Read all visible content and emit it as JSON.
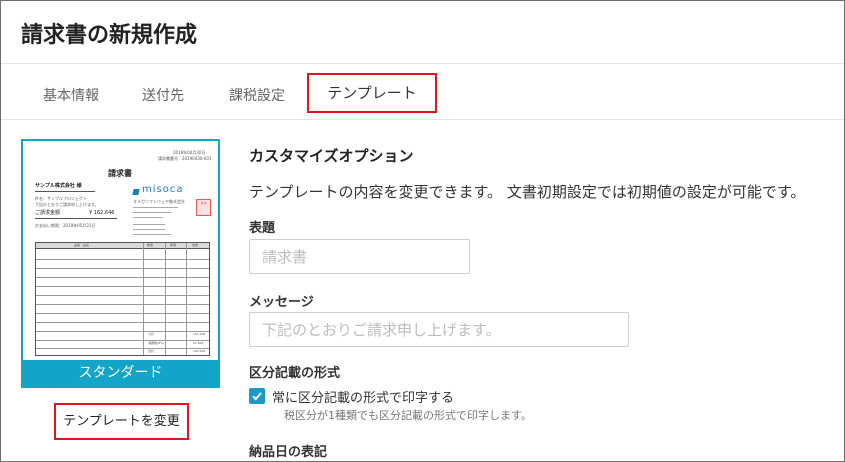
{
  "page": {
    "title": "請求書の新規作成"
  },
  "tabs": [
    {
      "label": "基本情報"
    },
    {
      "label": "送付先"
    },
    {
      "label": "課税設定"
    },
    {
      "label": "テンプレート"
    }
  ],
  "template_preview": {
    "name": "スタンダード",
    "doc_title": "請求書",
    "logo_text": "misoca",
    "client_name": "サンプル株式会社 様",
    "subject": "件名：サンプルプロジェクト",
    "greeting": "下記のとおりご請求申し上げます。",
    "amount_label": "ご請求金額",
    "amount_value": "¥ 162,646",
    "due_label": "お支払い期限：2019年05月31日",
    "date_top": "2019年04月30日",
    "invoice_no": "請求書番号：20190430-001",
    "sender_name": "オメガソフトウェア株式会社",
    "stamp_text": "見本",
    "table_headers": [
      "品番・品名",
      "数量",
      "単価",
      "金額"
    ],
    "summary_labels": [
      "小計",
      "消費税(8%)",
      "合計"
    ],
    "summary_values": [
      "151,000",
      "11,646",
      "162,646"
    ]
  },
  "change_template_button": {
    "label": "テンプレートを変更"
  },
  "customize": {
    "heading": "カスタマイズオプション",
    "description": "テンプレートの内容を変更できます。 文書初期設定では初期値の設定が可能です。",
    "title_field": {
      "label": "表題",
      "placeholder": "請求書",
      "value": ""
    },
    "message_field": {
      "label": "メッセージ",
      "placeholder": "下記のとおりご請求申し上げます。",
      "value": ""
    },
    "kubun": {
      "label": "区分記載の形式",
      "checkbox_label": "常に区分記載の形式で印字する",
      "checked": true,
      "helper": "税区分が1種類でも区分記載の形式で印字します。"
    },
    "delivery_label": "納品日の表記"
  },
  "colors": {
    "accent": "#13a5c7",
    "highlight_border": "#e0161e",
    "checkbox": "#1a9ac9"
  }
}
